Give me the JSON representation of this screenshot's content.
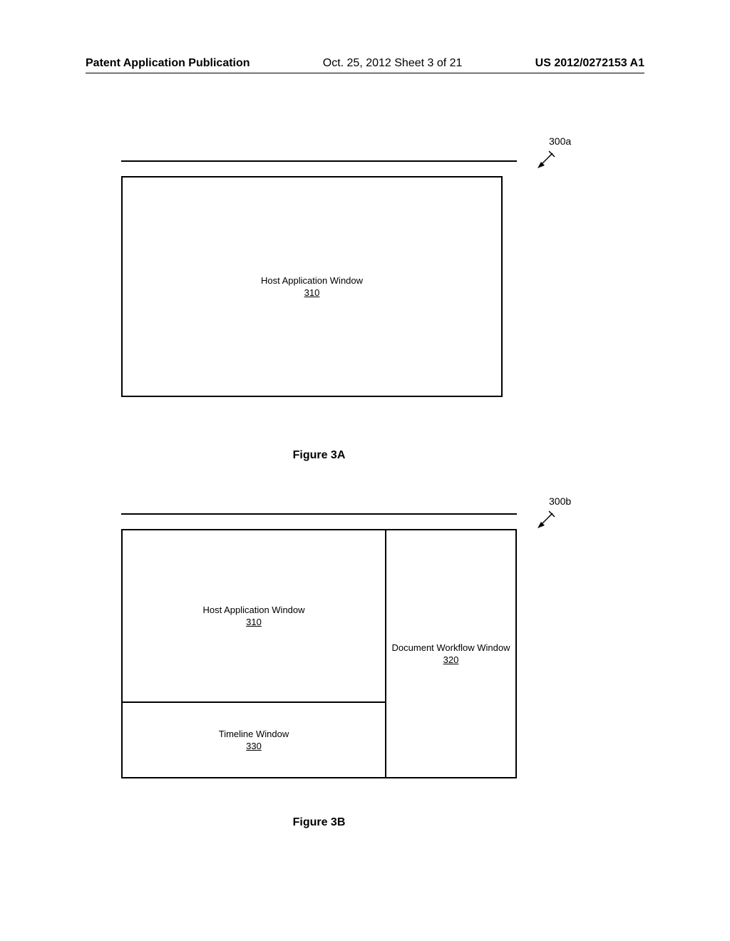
{
  "header": {
    "left": "Patent Application Publication",
    "center": "Oct. 25, 2012  Sheet 3 of 21",
    "right": "US 2012/0272153 A1"
  },
  "figure_a": {
    "callout": "300a",
    "host_title": "Host Application Window",
    "host_ref": "310",
    "caption": "Figure 3A"
  },
  "figure_b": {
    "callout": "300b",
    "host_title": "Host Application Window",
    "host_ref": "310",
    "workflow_title": "Document Workflow Window",
    "workflow_ref": "320",
    "timeline_title": "Timeline Window",
    "timeline_ref": "330",
    "caption": "Figure 3B"
  }
}
